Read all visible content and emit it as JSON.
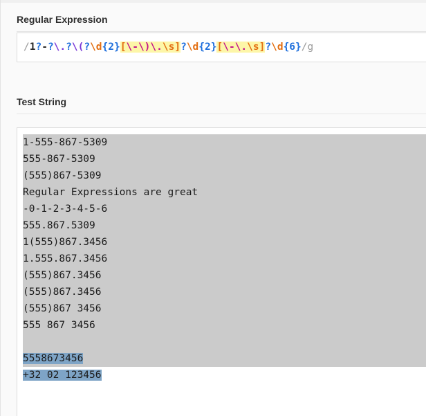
{
  "regex": {
    "label": "Regular Expression",
    "tokens": [
      {
        "t": "/",
        "k": "delim"
      },
      {
        "t": "1",
        "k": "lit"
      },
      {
        "t": "?",
        "k": "quant"
      },
      {
        "t": "-",
        "k": "lit"
      },
      {
        "t": "?",
        "k": "quant"
      },
      {
        "t": "\\.",
        "k": "esc"
      },
      {
        "t": "?",
        "k": "quant"
      },
      {
        "t": "\\(",
        "k": "esc"
      },
      {
        "t": "?",
        "k": "quant"
      },
      {
        "t": "\\d",
        "k": "class"
      },
      {
        "t": "{2}",
        "k": "quant"
      },
      {
        "t": "[",
        "k": "set-b"
      },
      {
        "t": "\\-\\)",
        "k": "set"
      },
      {
        "t": "\\.",
        "k": "set"
      },
      {
        "t": "\\s",
        "k": "set-b"
      },
      {
        "t": "]",
        "k": "set-b"
      },
      {
        "t": "?",
        "k": "quant"
      },
      {
        "t": "\\d",
        "k": "class"
      },
      {
        "t": "{2}",
        "k": "quant"
      },
      {
        "t": "[",
        "k": "set-b"
      },
      {
        "t": "\\-",
        "k": "set"
      },
      {
        "t": "\\.",
        "k": "set"
      },
      {
        "t": "\\s",
        "k": "set-b"
      },
      {
        "t": "]",
        "k": "set-b"
      },
      {
        "t": "?",
        "k": "quant"
      },
      {
        "t": "\\d",
        "k": "class"
      },
      {
        "t": "{6}",
        "k": "quant"
      },
      {
        "t": "/g",
        "k": "flag"
      }
    ]
  },
  "test": {
    "label": "Test String",
    "lines": [
      "1-555-867-5309",
      "555-867-5309",
      "(555)867-5309",
      "Regular Expressions are great",
      "-0-1-2-3-4-5-6",
      "555.867.5309",
      "1(555)867.3456",
      "1.555.867.3456",
      "(555)867.3456",
      "(555)867.3456",
      "(555)867 3456",
      "555 867 3456",
      "",
      "5558673456",
      "+32 02 123456"
    ]
  },
  "colors": {
    "match_gray": "#cbcbcb",
    "match_blue": "#7ea4c6"
  }
}
